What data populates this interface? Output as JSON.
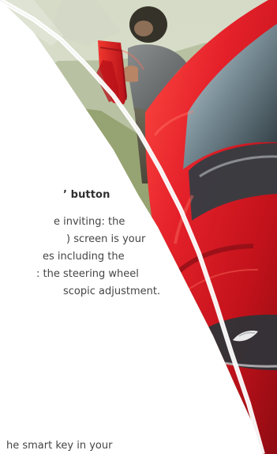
{
  "content": {
    "heading": "’ button",
    "paragraph_lines": [
      "e inviting: the",
      ") screen is your",
      "es including the",
      ": the steering wheel",
      "scopic adjustment."
    ],
    "footer": "he smart key in your"
  },
  "colors": {
    "car_red": "#d81d24",
    "background_white": "#ffffff",
    "text_dark": "#454545"
  }
}
